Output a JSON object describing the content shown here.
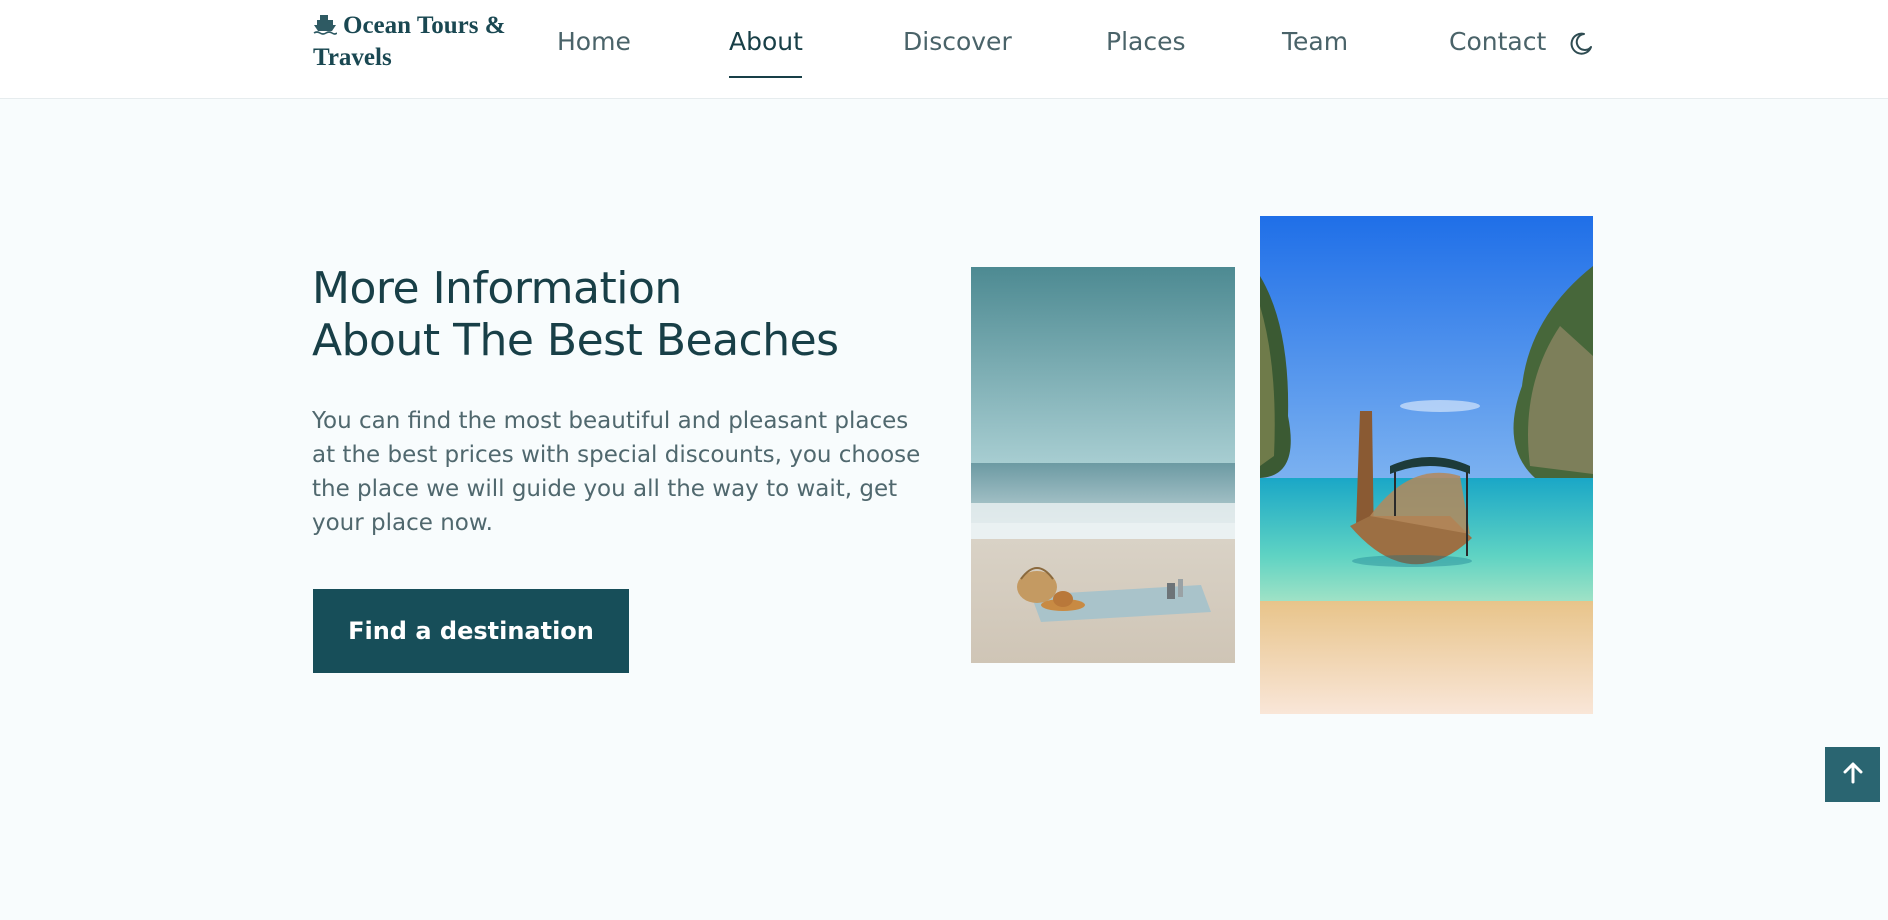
{
  "brand": {
    "name": "Ocean Tours & Travels",
    "icon": "ship-icon"
  },
  "nav": {
    "items": [
      {
        "label": "Home",
        "active": false
      },
      {
        "label": "About",
        "active": true
      },
      {
        "label": "Discover",
        "active": false
      },
      {
        "label": "Places",
        "active": false
      },
      {
        "label": "Team",
        "active": false
      },
      {
        "label": "Contact",
        "active": false
      }
    ],
    "theme_toggle_icon": "moon-icon"
  },
  "about": {
    "title_line1": "More Information",
    "title_line2": "About The Best Beaches",
    "description": "You can find the most beautiful and pleasant places at the best prices with special discounts, you choose the place we will guide you all the way to wait, get your place now.",
    "cta_label": "Find a destination"
  },
  "images": {
    "small": "beach-picnic-photo",
    "large": "longtail-boat-bay-photo"
  },
  "scroll_top_icon": "arrow-up-icon",
  "colors": {
    "primary": "#174e59",
    "heading": "#183f47",
    "text": "#50686e",
    "background": "#f8fcfd"
  }
}
